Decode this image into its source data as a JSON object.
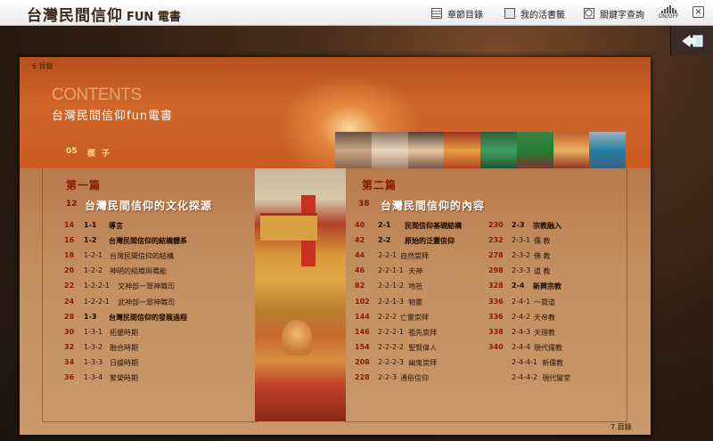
{
  "app": {
    "logo": "台灣民間信仰",
    "logo_suffix": "FUN 電書"
  },
  "toolbar": {
    "chapter_toc": "章節目錄",
    "my_bookmarks": "我的活書籤",
    "keyword_search": "關鍵字查詢",
    "sound_toggle": "ON/OFF",
    "close": "×"
  },
  "page": {
    "top_left_page": "6  目錄",
    "contents_word": "CONTENTS",
    "subtitle": "台灣民間信仰fun電書",
    "prologue_num": "05",
    "prologue_label": "楔 子",
    "bottom_right_page": "7  目錄"
  },
  "part1": {
    "heading": "第一篇",
    "chapter_num": "12",
    "chapter_title": "台灣民間信仰的文化探源",
    "entries": [
      {
        "page": "14",
        "code": "1-1",
        "title": "導言",
        "bold": true
      },
      {
        "page": "16",
        "code": "1-2",
        "title": "台灣民間信仰的結構體系",
        "bold": true
      },
      {
        "page": "18",
        "code": "1-2-1",
        "title": "台灣民間信仰的結構",
        "bold": false
      },
      {
        "page": "20",
        "code": "1-2-2",
        "title": "神明的組織與職能",
        "bold": false
      },
      {
        "page": "22",
        "code": "1-2-2-1",
        "title": "文神部一眾神職司",
        "bold": false
      },
      {
        "page": "24",
        "code": "1-2-2-1",
        "title": "武神部一眾神職司",
        "bold": false
      },
      {
        "page": "28",
        "code": "1-3",
        "title": "台灣民間信仰的發展過程",
        "bold": true
      },
      {
        "page": "30",
        "code": "1-3-1",
        "title": "拓墾時期",
        "bold": false
      },
      {
        "page": "32",
        "code": "1-3-2",
        "title": "融合時期",
        "bold": false
      },
      {
        "page": "34",
        "code": "1-3-3",
        "title": "日據時期",
        "bold": false
      },
      {
        "page": "36",
        "code": "1-3-4",
        "title": "繁榮時期",
        "bold": false
      }
    ]
  },
  "part2": {
    "heading": "第二篇",
    "chapter_num": "38",
    "chapter_title": "台灣民間信仰的內容",
    "col1": [
      {
        "page": "40",
        "code": "2-1",
        "title": "民間信仰基礎結構",
        "bold": true
      },
      {
        "page": "42",
        "code": "2-2",
        "title": "原始的泛靈信仰",
        "bold": true
      },
      {
        "page": "44",
        "code": "2-2-1",
        "title": "自然崇拜",
        "bold": false
      },
      {
        "page": "46",
        "code": "2-2-1-1",
        "title": "天神",
        "bold": false
      },
      {
        "page": "82",
        "code": "2-2-1-2",
        "title": "地祇",
        "bold": false
      },
      {
        "page": "102",
        "code": "2-2-1-3",
        "title": "物靈",
        "bold": false
      },
      {
        "page": "144",
        "code": "2-2-2",
        "title": "亡靈崇拜",
        "bold": false
      },
      {
        "page": "146",
        "code": "2-2-2-1",
        "title": "祖先崇拜",
        "bold": false
      },
      {
        "page": "154",
        "code": "2-2-2-2",
        "title": "聖賢偉人",
        "bold": false
      },
      {
        "page": "208",
        "code": "2-2-2-3",
        "title": "幽鬼崇拜",
        "bold": false
      },
      {
        "page": "228",
        "code": "2-2-3",
        "title": "通俗信仰",
        "bold": false
      }
    ],
    "col2": [
      {
        "page": "230",
        "code": "2-3",
        "title": "宗教融入",
        "bold": true
      },
      {
        "page": "232",
        "code": "2-3-1",
        "title": "儒 教",
        "bold": false
      },
      {
        "page": "278",
        "code": "2-3-2",
        "title": "佛 教",
        "bold": false
      },
      {
        "page": "298",
        "code": "2-3-3",
        "title": "道 教",
        "bold": false
      },
      {
        "page": "328",
        "code": "2-4",
        "title": "新興宗教",
        "bold": true
      },
      {
        "page": "336",
        "code": "2-4-1",
        "title": "一貫道",
        "bold": false
      },
      {
        "page": "336",
        "code": "2-4-2",
        "title": "天帝教",
        "bold": false
      },
      {
        "page": "338",
        "code": "2-4-3",
        "title": "天理教",
        "bold": false
      },
      {
        "page": "340",
        "code": "2-4-4",
        "title": "現代儒教",
        "bold": false
      },
      {
        "page": "",
        "code": "2-4-4-1",
        "title": "新儒教",
        "bold": false
      },
      {
        "page": "",
        "code": "2-4-4-2",
        "title": "現代鸞堂",
        "bold": false
      }
    ]
  },
  "icons": [
    "toc-icon",
    "bookmark-icon",
    "search-icon",
    "sound-icon",
    "close-icon",
    "back-arrow-icon"
  ]
}
